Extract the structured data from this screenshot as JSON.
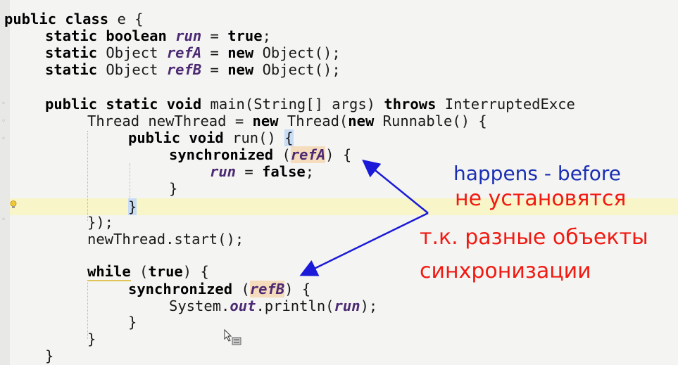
{
  "code": {
    "l1": [
      "public class",
      " e {"
    ],
    "l2": [
      "static boolean",
      "run",
      " = ",
      "true",
      ";"
    ],
    "l3": [
      "static",
      " Object ",
      "refA",
      " = ",
      "new",
      " Object();"
    ],
    "l4": [
      "static",
      " Object ",
      "refB",
      " = ",
      "new",
      " Object();"
    ],
    "l5": [
      "public static void",
      " main(String[] args) ",
      "throws",
      " InterruptedExce"
    ],
    "l6": [
      "Thread newThread = ",
      "new",
      " Thread(",
      "new",
      " Runnable() {"
    ],
    "l7": [
      "public void",
      " run() ",
      "{"
    ],
    "l8": [
      "synchronized",
      " (",
      "refA",
      ") {"
    ],
    "l9": [
      "run",
      " = ",
      "false",
      ";"
    ],
    "l10": [
      "}"
    ],
    "l11": [
      "}"
    ],
    "l12": [
      "});"
    ],
    "l13": [
      "newThread.start();"
    ],
    "l14": [
      "while",
      " (",
      "true",
      ") {"
    ],
    "l15": [
      "synchronized",
      " (",
      "refB",
      ") {"
    ],
    "l16": [
      "System.",
      "out",
      ".println(",
      "run",
      ");"
    ],
    "l17": [
      "}"
    ],
    "l18": [
      "}"
    ],
    "l19": [
      "}"
    ]
  },
  "annotation": {
    "line1": "happens - before",
    "line2": "не установятся",
    "line3": "т.к. разные объекты",
    "line4": "синхронизации"
  },
  "colors": {
    "annotation_blue": "#1a2fb3",
    "annotation_red": "#f11a12",
    "arrow": "#1a1ad8"
  }
}
